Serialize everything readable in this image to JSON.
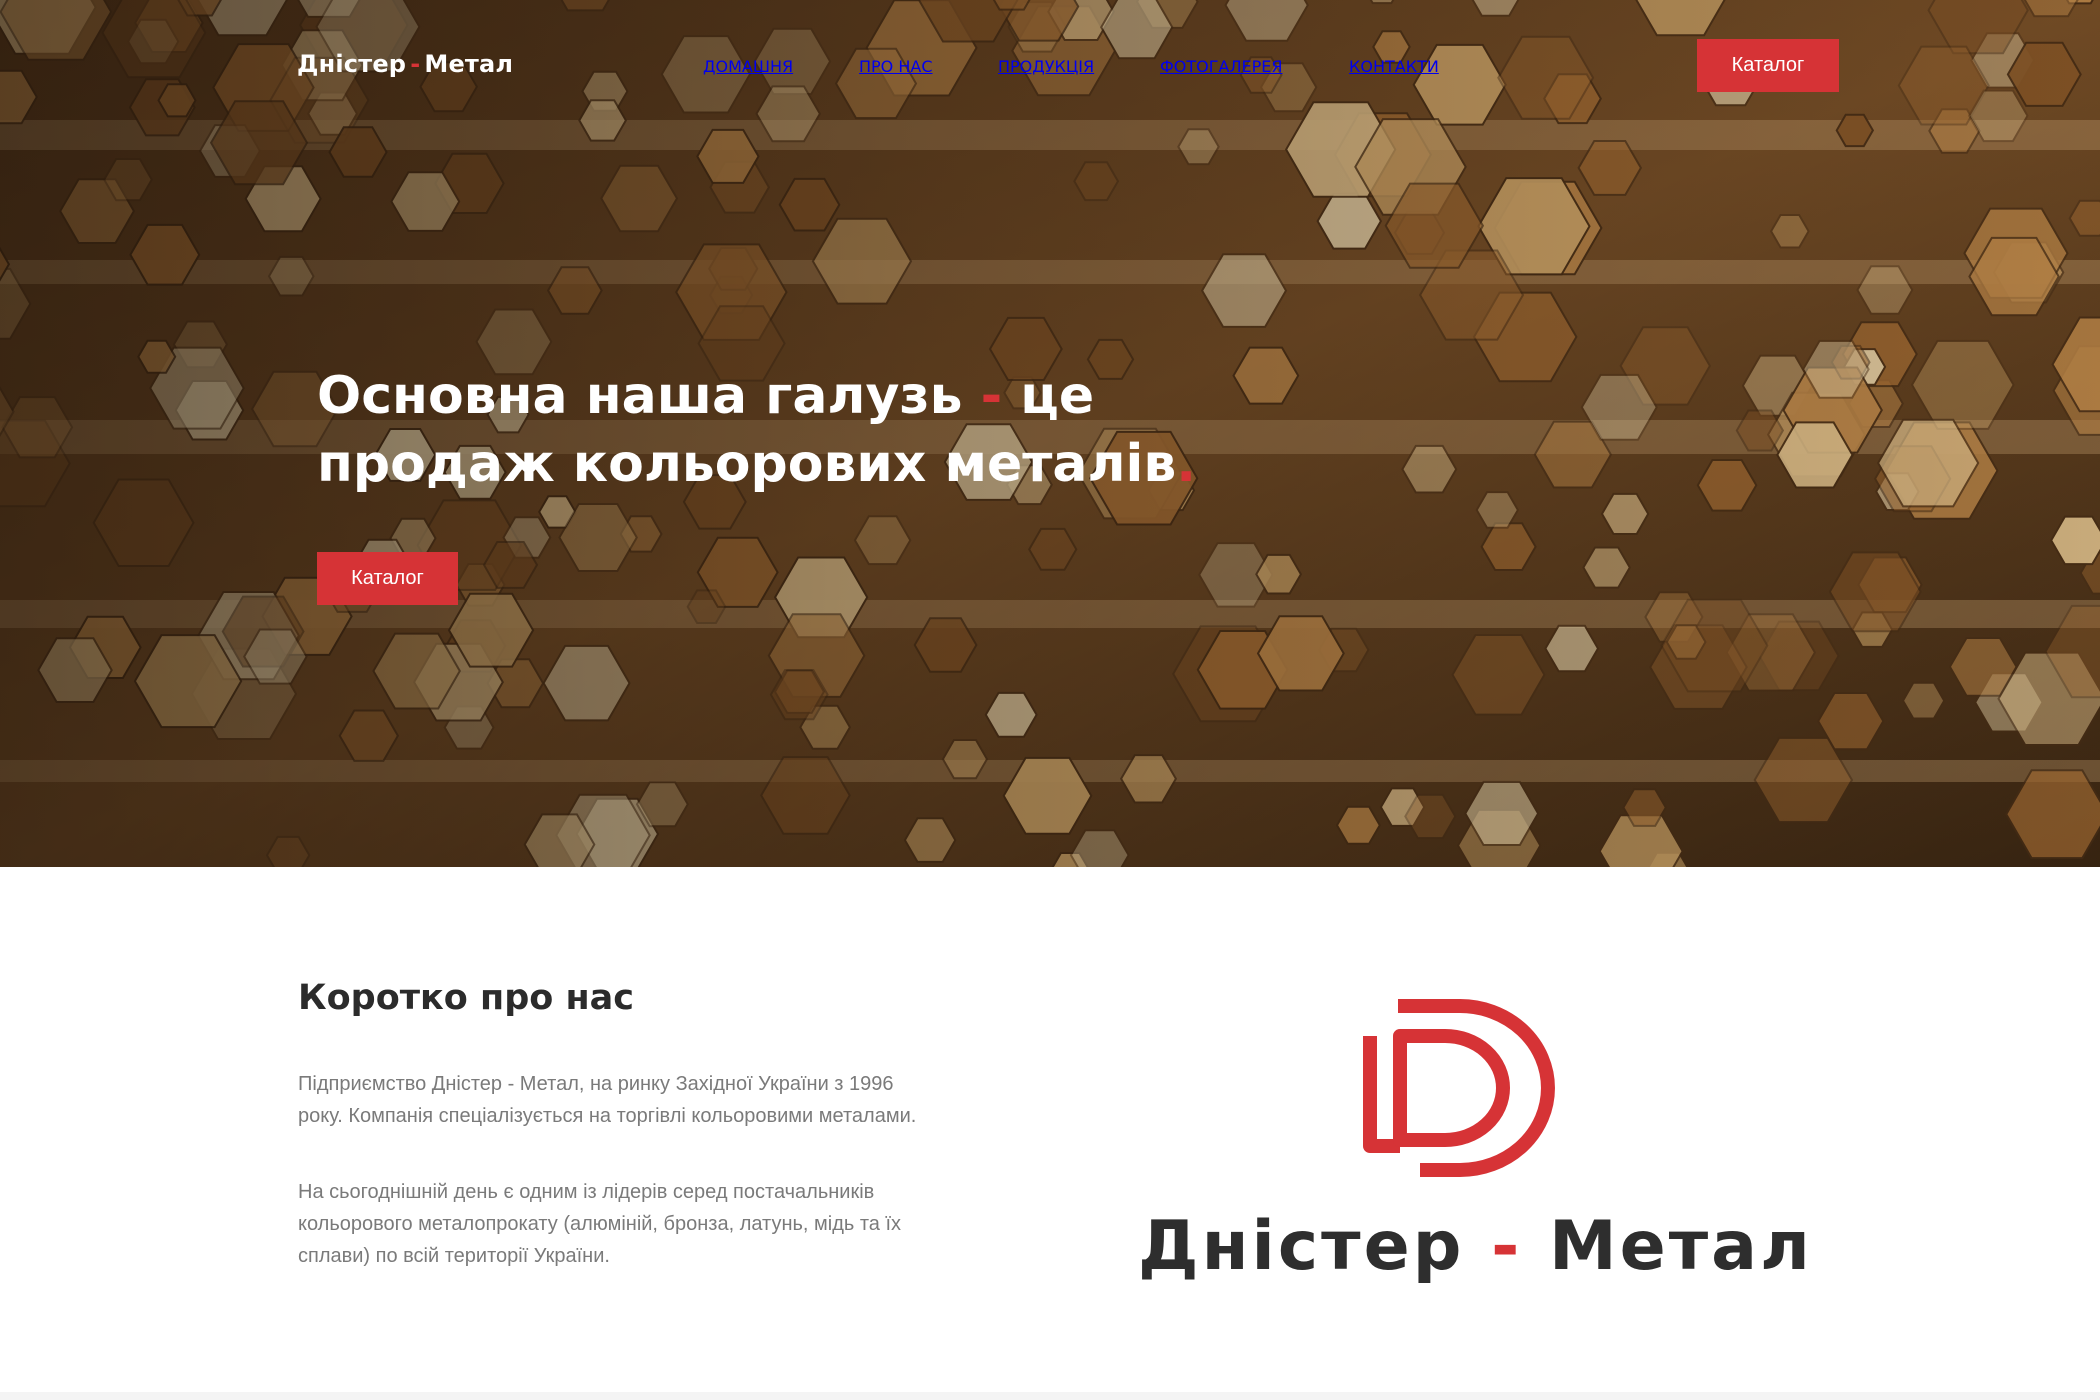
{
  "header": {
    "brand_part1": "Дністер",
    "brand_dash": "-",
    "brand_part2": "Метал",
    "nav": [
      {
        "label": "ДОМАШНЯ"
      },
      {
        "label": "ПРО НАС"
      },
      {
        "label": "ПРОДУКЦІЯ"
      },
      {
        "label": "ФОТОГАЛЕРЕЯ"
      },
      {
        "label": "КОНТАКТИ"
      }
    ],
    "catalog_button": "Каталог"
  },
  "hero": {
    "title_part1": "Основна наша галузь",
    "title_dash": "-",
    "title_part2": "це",
    "title_line2": "продаж кольорових металів",
    "title_dot": ".",
    "catalog_button": "Каталог"
  },
  "about": {
    "title": "Коротко про нас",
    "paragraph1": "Підприємство Дністер - Метал, на ринку Західної України з 1996 року. Компанія спеціалізується на торгівлі кольоровими металами.",
    "paragraph2": "На сьогоднішній день є одним із лідерів серед постачальників кольорового металопрокату (алюміній, бронза, латунь, мідь та їх сплави) по всій території України."
  },
  "logo": {
    "text_part1": "Дністер",
    "text_dash": "-",
    "text_part2": "Метал"
  },
  "colors": {
    "accent": "#d63336",
    "text_dark": "#2b2b2b",
    "text_muted": "#7a7a7a"
  }
}
